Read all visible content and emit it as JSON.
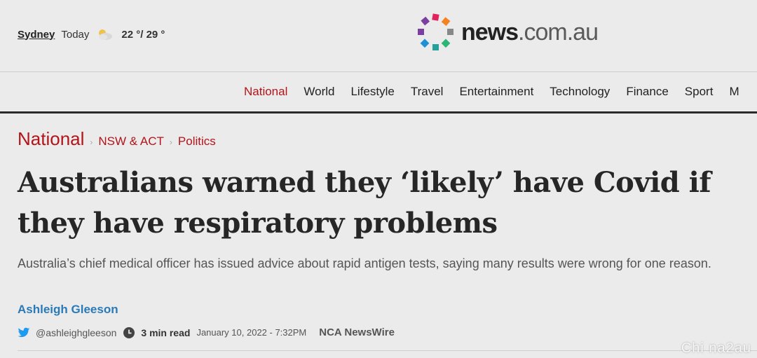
{
  "weather": {
    "city": "Sydney",
    "today": "Today",
    "icon": "partly-cloudy-icon",
    "temp": "22 °/ 29 °"
  },
  "logo": {
    "news": "news",
    "domain": ".com.au",
    "colors": [
      "#e0245e",
      "#f58220",
      "#7a3fa0",
      "#888888",
      "#1e90d6",
      "#2bb673",
      "#26a09a"
    ]
  },
  "nav": {
    "items": [
      "National",
      "World",
      "Lifestyle",
      "Travel",
      "Entertainment",
      "Technology",
      "Finance",
      "Sport",
      "M"
    ],
    "active": "National",
    "active_color": "#b3141a"
  },
  "breadcrumb": {
    "section": "National",
    "sub1": "NSW & ACT",
    "sub2": "Politics"
  },
  "article": {
    "headline": "Australians warned they ‘likely’ have Covid if they have respiratory problems",
    "standfirst": "Australia’s chief medical officer has issued advice about rapid antigen tests, saying many results were wrong for one reason.",
    "author": "Ashleigh Gleeson",
    "twitter": "@ashleighgleeson",
    "read_time": "3 min read",
    "date": "January 10, 2022 - 7:32PM",
    "source": "NCA NewsWire"
  },
  "watermark": "Chi na2au"
}
